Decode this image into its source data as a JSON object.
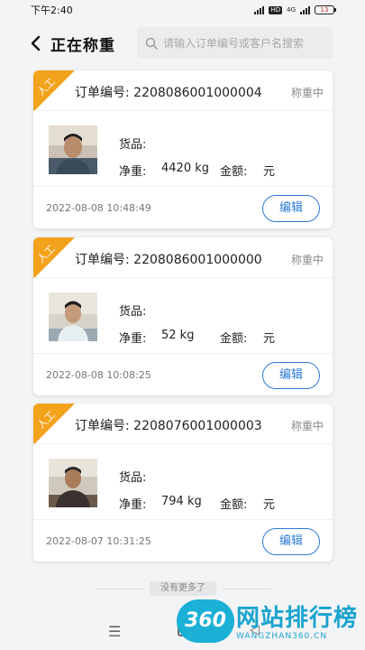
{
  "status_bar": {
    "time": "下午2:40",
    "hd_badge": "HD",
    "network": "4G",
    "battery": "13"
  },
  "header": {
    "title": "正在称重",
    "search_placeholder": "请输入订单编号或客户名搜索"
  },
  "orders": [
    {
      "badge": "人工",
      "order_label": "订单编号:",
      "order_no": "2208086001000004",
      "status": "称重中",
      "goods_label": "货品:",
      "weight_label": "净重:",
      "weight": "4420 kg",
      "amount_label": "金额:",
      "amount_unit": "元",
      "timestamp": "2022-08-08 10:48:49",
      "edit_label": "编辑"
    },
    {
      "badge": "人工",
      "order_label": "订单编号:",
      "order_no": "2208086001000000",
      "status": "称重中",
      "goods_label": "货品:",
      "weight_label": "净重:",
      "weight": "52 kg",
      "amount_label": "金额:",
      "amount_unit": "元",
      "timestamp": "2022-08-08 10:08:25",
      "edit_label": "编辑"
    },
    {
      "badge": "人工",
      "order_label": "订单编号:",
      "order_no": "2208076001000003",
      "status": "称重中",
      "goods_label": "货品:",
      "weight_label": "净重:",
      "weight": "794 kg",
      "amount_label": "金额:",
      "amount_unit": "元",
      "timestamp": "2022-08-07 10:31:25",
      "edit_label": "编辑"
    }
  ],
  "list_footer": {
    "no_more": "没有更多了"
  },
  "navbar": {
    "menu_icon": "menu-icon",
    "home_icon": "home-icon",
    "back_icon": "back-icon"
  },
  "watermark": {
    "logo_text": "360",
    "title": "网站排行榜",
    "subtitle": "WANGZHAN360.CN"
  },
  "colors": {
    "accent": "#2b7ad6",
    "badge": "#f3a21c",
    "background": "#f3f4f6"
  }
}
